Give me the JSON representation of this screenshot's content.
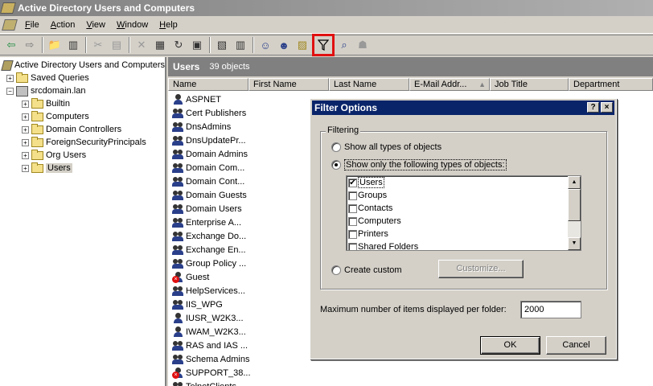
{
  "window": {
    "title": "Active Directory Users and Computers"
  },
  "menu": [
    {
      "label": "File",
      "key": "F",
      "rest": "ile"
    },
    {
      "label": "Action",
      "key": "A",
      "rest": "ction"
    },
    {
      "label": "View",
      "key": "V",
      "rest": "iew"
    },
    {
      "label": "Window",
      "key": "W",
      "rest": "indow"
    },
    {
      "label": "Help",
      "key": "H",
      "rest": "elp"
    }
  ],
  "tree": {
    "root": "Active Directory Users and Computers",
    "saved_queries": "Saved Queries",
    "domain": "srcdomain.lan",
    "children": [
      "Builtin",
      "Computers",
      "Domain Controllers",
      "ForeignSecurityPrincipals",
      "Org Users",
      "Users"
    ]
  },
  "pane": {
    "title": "Users",
    "count": "39 objects"
  },
  "columns": [
    "Name",
    "First Name",
    "Last Name",
    "E-Mail Addr...",
    "Job Title",
    "Department"
  ],
  "rows": [
    {
      "name": "ASPNET",
      "icon": "user-icon"
    },
    {
      "name": "Cert Publishers",
      "icon": "group-icon"
    },
    {
      "name": "DnsAdmins",
      "icon": "group-icon"
    },
    {
      "name": "DnsUpdatePr...",
      "icon": "group-icon"
    },
    {
      "name": "Domain Admins",
      "icon": "group-icon"
    },
    {
      "name": "Domain Com...",
      "icon": "group-icon"
    },
    {
      "name": "Domain Cont...",
      "icon": "group-icon"
    },
    {
      "name": "Domain Guests",
      "icon": "group-icon"
    },
    {
      "name": "Domain Users",
      "icon": "group-icon"
    },
    {
      "name": "Enterprise A...",
      "icon": "group-icon"
    },
    {
      "name": "Exchange Do...",
      "icon": "group-icon"
    },
    {
      "name": "Exchange En...",
      "icon": "group-icon"
    },
    {
      "name": "Group Policy ...",
      "icon": "group-icon"
    },
    {
      "name": "Guest",
      "icon": "disabled-user-icon"
    },
    {
      "name": "HelpServices...",
      "icon": "group-icon"
    },
    {
      "name": "IIS_WPG",
      "icon": "group-icon"
    },
    {
      "name": "IUSR_W2K3...",
      "icon": "user-icon"
    },
    {
      "name": "IWAM_W2K3...",
      "icon": "user-icon"
    },
    {
      "name": "RAS and IAS ...",
      "icon": "group-icon"
    },
    {
      "name": "Schema Admins",
      "icon": "group-icon"
    },
    {
      "name": "SUPPORT_38...",
      "icon": "disabled-user-icon"
    },
    {
      "name": "TelnetClients",
      "icon": "group-icon"
    }
  ],
  "dialog": {
    "title": "Filter Options",
    "help": "?",
    "close": "×",
    "group_label": "Filtering",
    "radio_all": "Show all types of objects",
    "radio_only": "Show only the following types of objects:",
    "types": [
      {
        "label": "Users",
        "checked": true
      },
      {
        "label": "Groups",
        "checked": false
      },
      {
        "label": "Contacts",
        "checked": false
      },
      {
        "label": "Computers",
        "checked": false
      },
      {
        "label": "Printers",
        "checked": false
      },
      {
        "label": "Shared Folders",
        "checked": false
      }
    ],
    "radio_custom": "Create custom",
    "customize": "Customize...",
    "max_label": "Maximum number of items displayed per folder:",
    "max_value": "2000",
    "ok": "OK",
    "cancel": "Cancel"
  },
  "colors": {
    "dialog_title": "#0a246a",
    "highlight": "#e01010",
    "face": "#d4d0c8"
  }
}
